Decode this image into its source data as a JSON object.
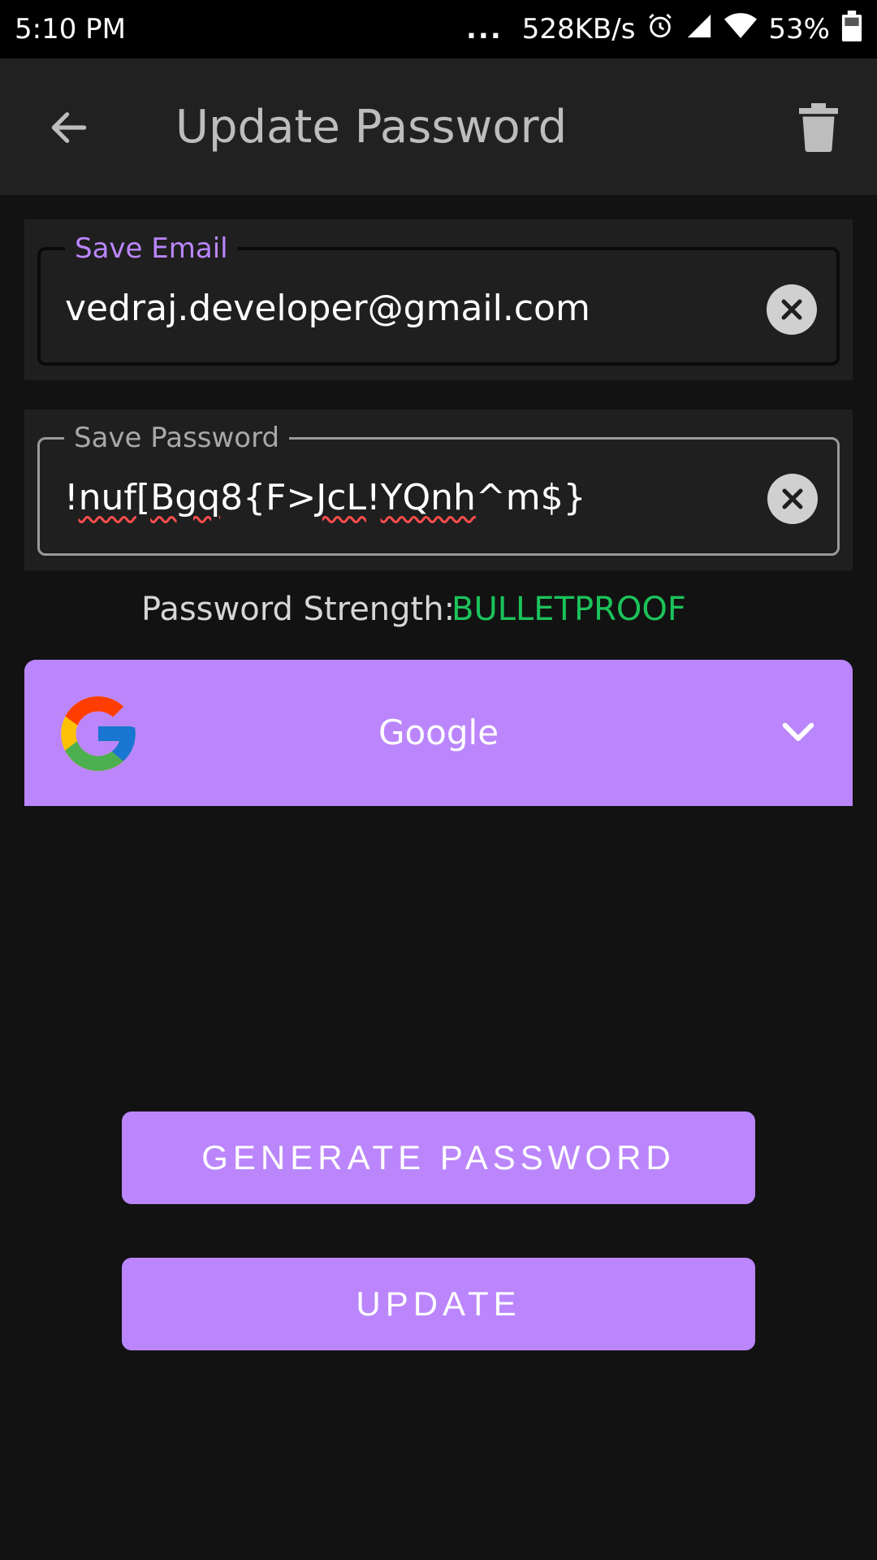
{
  "status_bar": {
    "time": "5:10 PM",
    "dots": "...",
    "speed": "528KB/s",
    "battery": "53%"
  },
  "toolbar": {
    "title": "Update Password",
    "back_icon": "arrow-left-icon",
    "delete_icon": "trash-icon"
  },
  "email_field": {
    "label": "Save Email",
    "value": "vedraj.developer@gmail.com"
  },
  "password_field": {
    "label": "Save Password",
    "value_parts": [
      "!",
      "nuf",
      "[",
      "Bgq",
      "8{F>",
      "JcL",
      "!",
      "YQnh",
      "^m$}"
    ]
  },
  "strength": {
    "label": "Password Strength:",
    "value": "BULLETPROOF",
    "color": "#1bc35a"
  },
  "account": {
    "selected": "Google",
    "icon": "google-logo-icon"
  },
  "buttons": {
    "generate": "GENERATE PASSWORD",
    "update": "UPDATE"
  },
  "colors": {
    "accent": "#bb86fc",
    "background": "#121212",
    "surface": "#1f1f1f",
    "toolbar": "#212121"
  }
}
